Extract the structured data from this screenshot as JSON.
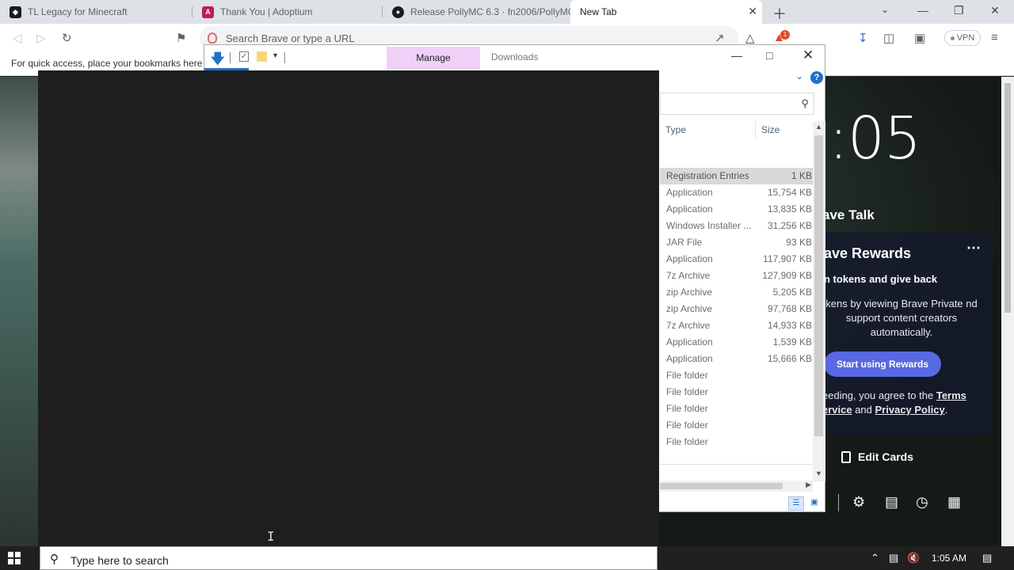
{
  "browser": {
    "tabs": [
      {
        "title": "TL Legacy for Minecraft",
        "favicon_color": "#1a1a1a"
      },
      {
        "title": "Thank You | Adoptium",
        "favicon_color": "#c2185b"
      },
      {
        "title": "Release PollyMC 6.3 · fn2006/PollyMC",
        "favicon_color": "#1a1a1a"
      },
      {
        "title": "New Tab",
        "favicon_color": ""
      }
    ],
    "omnibox_placeholder": "Search Brave or type a URL",
    "rewards_badge": "1",
    "vpn_label": "VPN",
    "bookmarks_hint": "For quick access, place your bookmarks here o"
  },
  "new_tab": {
    "clock": ":05",
    "talk_title": "ave Talk",
    "rewards": {
      "title": "ave Rewards",
      "subtitle": "n tokens and give back",
      "description": "kens by viewing Brave Private nd support content creators automatically.",
      "button": "Start using Rewards",
      "legal_prefix": "eeding, you agree to the ",
      "legal_terms": "Terms",
      "legal_mid": " ervice",
      "legal_and": " and ",
      "legal_privacy": "Privacy Policy",
      "legal_end": "."
    },
    "edit_cards": "Edit Cards"
  },
  "explorer": {
    "context_tab": "Manage",
    "title": "Downloads",
    "columns": {
      "type": "Type",
      "size": "Size"
    },
    "rows": [
      {
        "type": "Registration Entries",
        "size": "1 KB",
        "selected": true
      },
      {
        "type": "Application",
        "size": "15,754 KB"
      },
      {
        "type": "Application",
        "size": "13,835 KB"
      },
      {
        "type": "Windows Installer ...",
        "size": "31,256 KB"
      },
      {
        "type": "JAR File",
        "size": "93 KB"
      },
      {
        "type": "Application",
        "size": "117,907 KB"
      },
      {
        "type": "7z Archive",
        "size": "127,909 KB"
      },
      {
        "type": "zip Archive",
        "size": "5,205 KB"
      },
      {
        "type": "zip Archive",
        "size": "97,768 KB"
      },
      {
        "type": "7z Archive",
        "size": "14,933 KB"
      },
      {
        "type": "Application",
        "size": "1,539 KB"
      },
      {
        "type": "Application",
        "size": "15,666 KB"
      },
      {
        "type": "File folder",
        "size": ""
      },
      {
        "type": "File folder",
        "size": ""
      },
      {
        "type": "File folder",
        "size": ""
      },
      {
        "type": "File folder",
        "size": ""
      },
      {
        "type": "File folder",
        "size": ""
      }
    ]
  },
  "taskbar": {
    "search_placeholder": "Type here to search",
    "time": "1:05 AM"
  },
  "colors": {
    "accent_blue": "#1e73c8",
    "manage_tab": "#f0d0f7",
    "rewards_button": "#5968e3",
    "overlay": "#1e1e1e"
  }
}
